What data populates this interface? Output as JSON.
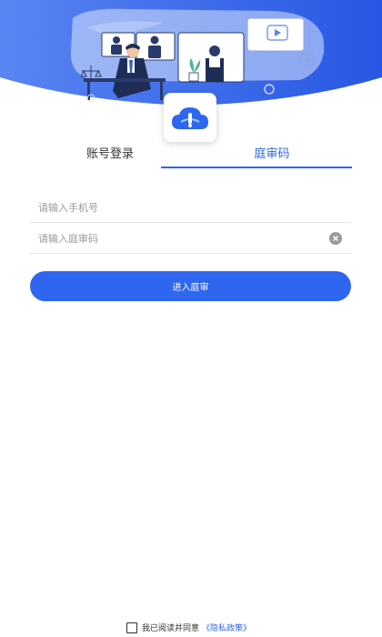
{
  "tabs": [
    {
      "label": "账号登录",
      "active": false
    },
    {
      "label": "庭审码",
      "active": true
    }
  ],
  "form": {
    "phone_placeholder": "请输入手机号",
    "code_placeholder": "请输入庭审码",
    "submit_label": "进入庭审"
  },
  "agreement": {
    "text": "我已阅读并同意",
    "link": "《隐私政策》"
  },
  "icons": {
    "status": [
      "wifi-icon",
      "signal-icon",
      "battery-icon"
    ],
    "logo": "cloud-logo-icon",
    "clear": "clear-icon"
  },
  "colors": {
    "accent": "#2f66f0",
    "hero_gradient_start": "#4f7bf2",
    "hero_gradient_end": "#2a5ae6"
  }
}
